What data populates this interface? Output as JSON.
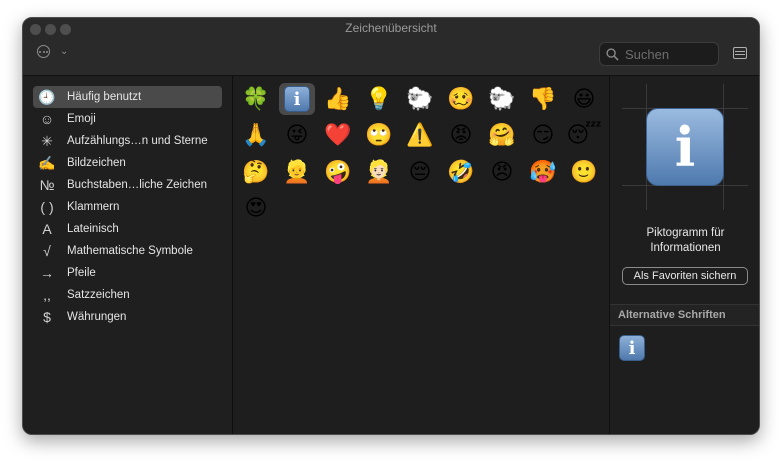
{
  "window": {
    "title": "Zeichenübersicht"
  },
  "search": {
    "placeholder": "Suchen",
    "value": ""
  },
  "sidebar": {
    "items": [
      {
        "label": "Häufig benutzt",
        "icon": "clock-icon",
        "glyph": "🕘",
        "selected": true
      },
      {
        "label": "Emoji",
        "icon": "smiley-icon",
        "glyph": "☺",
        "selected": false
      },
      {
        "label": "Aufzählungs…n und Sterne",
        "icon": "asterisk-icon",
        "glyph": "✳",
        "selected": false
      },
      {
        "label": "Bildzeichen",
        "icon": "pencil-icon",
        "glyph": "✍",
        "selected": false
      },
      {
        "label": "Buchstaben…liche Zeichen",
        "icon": "numero-icon",
        "glyph": "№",
        "selected": false
      },
      {
        "label": "Klammern",
        "icon": "parentheses-icon",
        "glyph": "( )",
        "selected": false
      },
      {
        "label": "Lateinisch",
        "icon": "letter-a-icon",
        "glyph": "A",
        "selected": false
      },
      {
        "label": "Mathematische Symbole",
        "icon": "square-root-icon",
        "glyph": "√",
        "selected": false
      },
      {
        "label": "Pfeile",
        "icon": "arrow-icon",
        "glyph": "→",
        "selected": false
      },
      {
        "label": "Satzzeichen",
        "icon": "punctuation-icon",
        "glyph": ",,",
        "selected": false
      },
      {
        "label": "Währungen",
        "icon": "dollar-icon",
        "glyph": "$",
        "selected": false
      }
    ]
  },
  "grid": {
    "rows": [
      [
        "🍀",
        "ℹ️",
        "👍",
        "💡",
        "🐑",
        "🥴",
        "🐑",
        "👎",
        "😃"
      ],
      [
        "🙏",
        "😜",
        "❤️",
        "🙄",
        "⚠️",
        "😡",
        "🤗",
        "😏",
        "😴"
      ],
      [
        "🤔",
        "👱",
        "🤪",
        "👱🏻",
        "😔",
        "🤣",
        "😠",
        "🥵",
        "🙂"
      ],
      [
        "😍"
      ]
    ],
    "selected": [
      0,
      1
    ]
  },
  "detail": {
    "glyph": "i",
    "name_line1": "Piktogramm für",
    "name_line2": "Informationen",
    "favorite_button": "Als Favoriten sichern",
    "alternatives_heading": "Alternative Schriften"
  },
  "colors": {
    "window_bg": "#1e1e1e",
    "selection": "#4a4a4a",
    "info_blue": "#5b83b5"
  }
}
